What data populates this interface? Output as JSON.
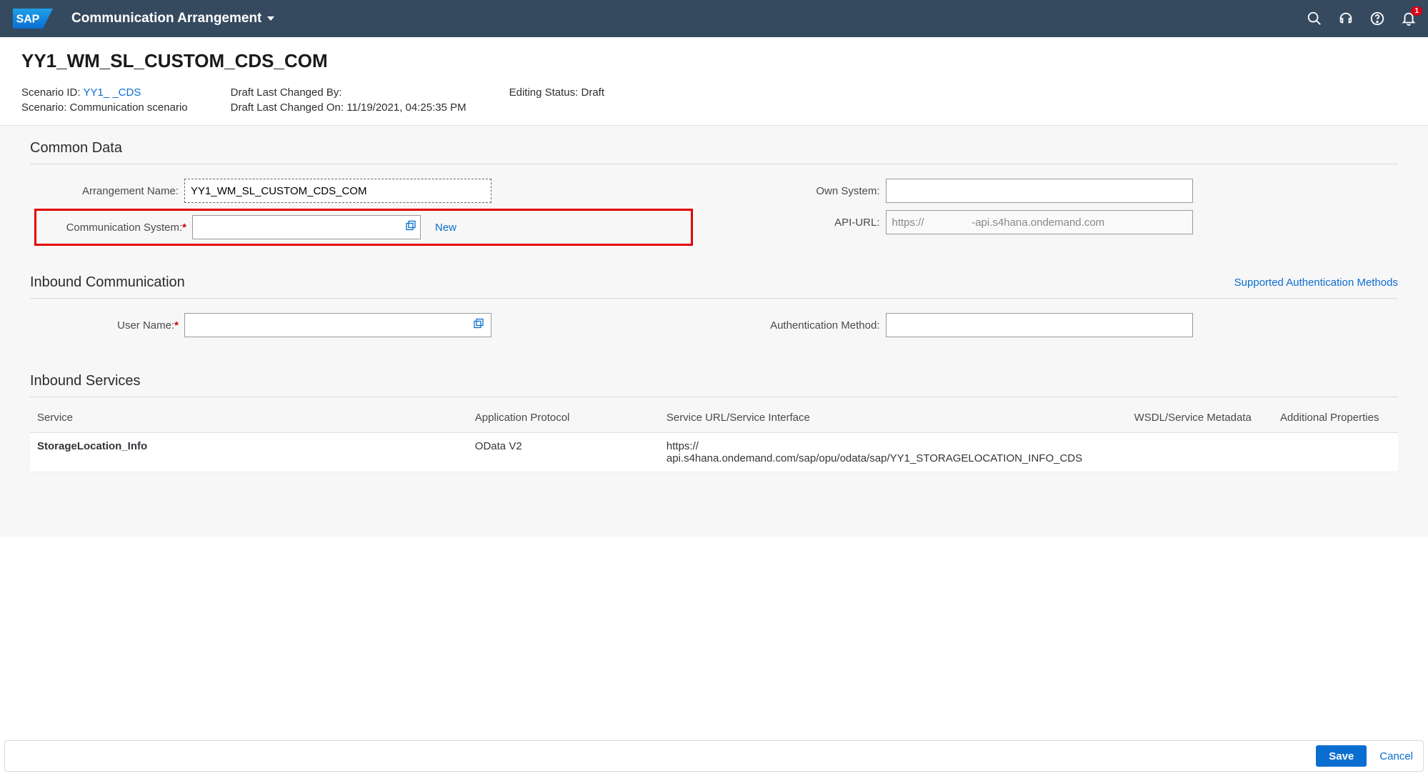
{
  "shell": {
    "app_title": "Communication Arrangement",
    "notif_count": "1"
  },
  "header": {
    "title": "YY1_WM_SL_CUSTOM_CDS_COM",
    "scenario_id_label": "Scenario ID:",
    "scenario_id_link": "YY1_                       _CDS",
    "scenario_label": "Scenario:",
    "scenario_value": "Communication scenario",
    "changed_by_label": "Draft Last Changed By:",
    "changed_by_value": "",
    "changed_on_label": "Draft Last Changed On:",
    "changed_on_value": "11/19/2021, 04:25:35 PM",
    "editing_status_label": "Editing Status:",
    "editing_status_value": "Draft"
  },
  "common": {
    "section_title": "Common Data",
    "arr_name_label": "Arrangement Name:",
    "arr_name_value": "YY1_WM_SL_CUSTOM_CDS_COM",
    "comm_system_label": "Communication System:",
    "comm_system_value": "",
    "new_label": "New",
    "own_system_label": "Own System:",
    "own_system_value": "",
    "api_url_label": "API-URL:",
    "api_url_value": "https://                -api.s4hana.ondemand.com"
  },
  "inbound": {
    "section_title": "Inbound Communication",
    "auth_methods_link": "Supported Authentication Methods",
    "user_name_label": "User Name:",
    "user_name_value": "",
    "auth_method_label": "Authentication Method:",
    "auth_method_value": ""
  },
  "services": {
    "section_title": "Inbound Services",
    "cols": {
      "service": "Service",
      "protocol": "Application Protocol",
      "url": "Service URL/Service Interface",
      "wsdl": "WSDL/Service Metadata",
      "props": "Additional Properties"
    },
    "rows": [
      {
        "service": "StorageLocation_Info",
        "protocol": "OData V2",
        "url": "https://\napi.s4hana.ondemand.com/sap/opu/odata/sap/YY1_STORAGELOCATION_INFO_CDS"
      }
    ]
  },
  "footer": {
    "save": "Save",
    "cancel": "Cancel"
  }
}
